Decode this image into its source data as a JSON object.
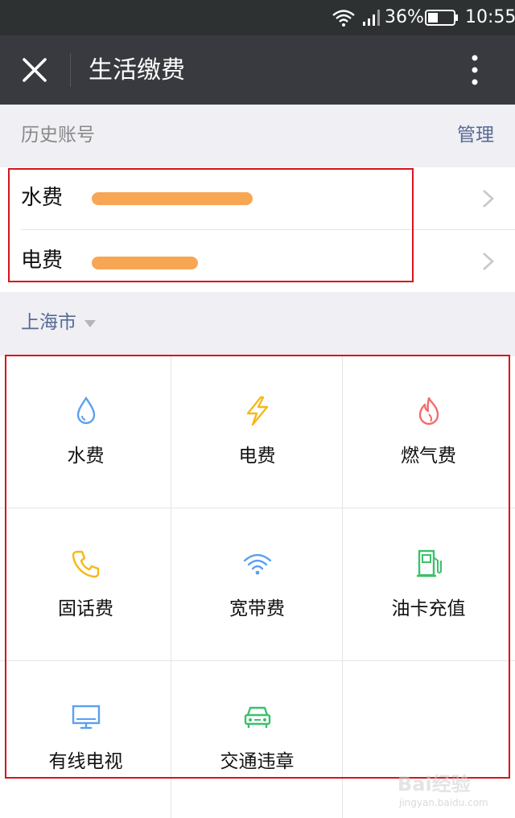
{
  "status_bar": {
    "battery_percent": "36%",
    "time": "10:55"
  },
  "nav": {
    "title": "生活缴费"
  },
  "history": {
    "label": "历史账号",
    "manage_label": "管理",
    "accounts": [
      {
        "name": "水费"
      },
      {
        "name": "电费"
      }
    ]
  },
  "city": {
    "name": "上海市"
  },
  "services": [
    {
      "label": "水费",
      "icon": "water-drop-icon",
      "color": "#5aa0f0"
    },
    {
      "label": "电费",
      "icon": "lightning-icon",
      "color": "#f5b81b"
    },
    {
      "label": "燃气费",
      "icon": "flame-icon",
      "color": "#f26d6d"
    },
    {
      "label": "固话费",
      "icon": "telephone-icon",
      "color": "#f5b81b"
    },
    {
      "label": "宽带费",
      "icon": "wifi-icon",
      "color": "#5aa0f0"
    },
    {
      "label": "油卡充值",
      "icon": "fuel-pump-icon",
      "color": "#3cc06b"
    },
    {
      "label": "有线电视",
      "icon": "tv-monitor-icon",
      "color": "#5aa0f0"
    },
    {
      "label": "交通违章",
      "icon": "car-icon",
      "color": "#3cc06b"
    }
  ],
  "watermark": {
    "line1": "Bai经验",
    "line2": "jingyan.baidu.com"
  },
  "colors": {
    "nav_bg": "#393a3f",
    "status_bg": "#2e3132",
    "link": "#576b95",
    "highlight": "#d8141b",
    "mask": "#f7a654"
  }
}
